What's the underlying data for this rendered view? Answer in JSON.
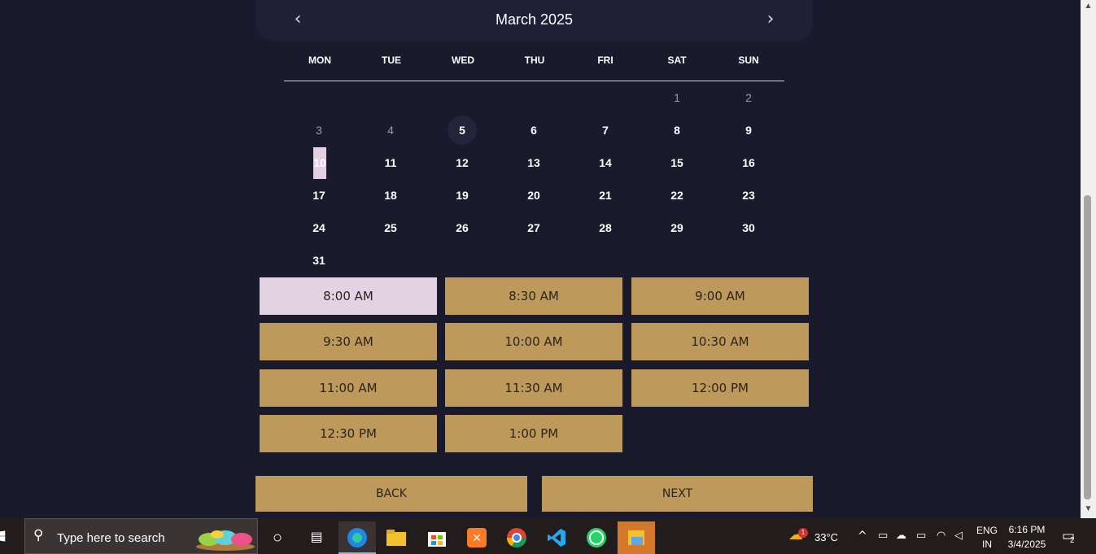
{
  "calendar": {
    "month_title": "March 2025",
    "prev_label": "‹",
    "next_label": "›",
    "weekdays": [
      "MON",
      "TUE",
      "WED",
      "THU",
      "FRI",
      "SAT",
      "SUN"
    ],
    "days": [
      "1",
      "2",
      "3",
      "4",
      "5",
      "6",
      "7",
      "8",
      "9",
      "10",
      "11",
      "12",
      "13",
      "14",
      "15",
      "16",
      "17",
      "18",
      "19",
      "20",
      "21",
      "22",
      "23",
      "24",
      "25",
      "26",
      "27",
      "28",
      "29",
      "30",
      "31"
    ]
  },
  "time_slots": [
    "8:00 AM",
    "8:30 AM",
    "9:00 AM",
    "9:30 AM",
    "10:00 AM",
    "10:30 AM",
    "11:00 AM",
    "11:30 AM",
    "12:00 PM",
    "12:30 PM",
    "1:00 PM"
  ],
  "actions": {
    "back_label": "BACK",
    "next_label": "NEXT"
  },
  "taskbar": {
    "search_placeholder": "Type here to search",
    "weather": "33°C",
    "weather_badge": "1",
    "lang_top": "ENG",
    "lang_bottom": "IN",
    "time": "6:16 PM",
    "date": "3/4/2025",
    "notifications": "2"
  },
  "colors": {
    "background": "#191a2b",
    "slot": "#bd9a5c",
    "slot_active": "#e2d2e3"
  }
}
